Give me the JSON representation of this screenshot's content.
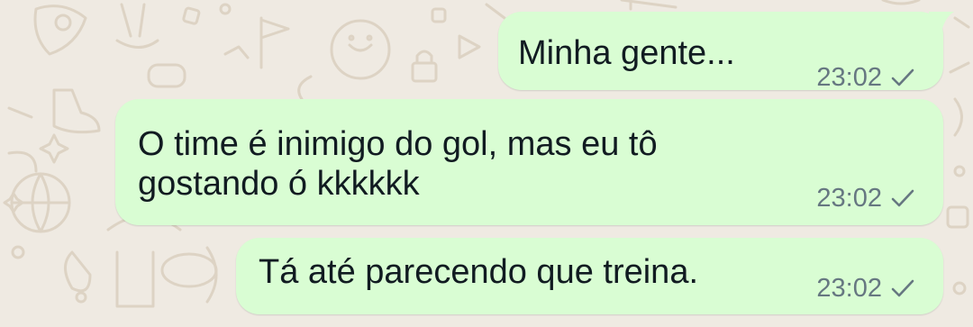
{
  "chat": {
    "messages": [
      {
        "text_lines": [
          "Minha gente..."
        ],
        "time": "23:02",
        "status": "sent"
      },
      {
        "text_lines": [
          "O time é inimigo do gol, mas eu tô",
          "gostando ó kkkkkk"
        ],
        "time": "23:02",
        "status": "sent"
      },
      {
        "text_lines": [
          "Tá até parecendo que treina."
        ],
        "time": "23:02",
        "status": "sent"
      }
    ]
  },
  "colors": {
    "background": "#efeae2",
    "outgoing_bubble": "#d9fdd3",
    "message_text": "#111b21",
    "meta_text": "#667781"
  },
  "icons": {
    "status": "single-check-icon",
    "wallpaper": "doodle-pattern"
  }
}
